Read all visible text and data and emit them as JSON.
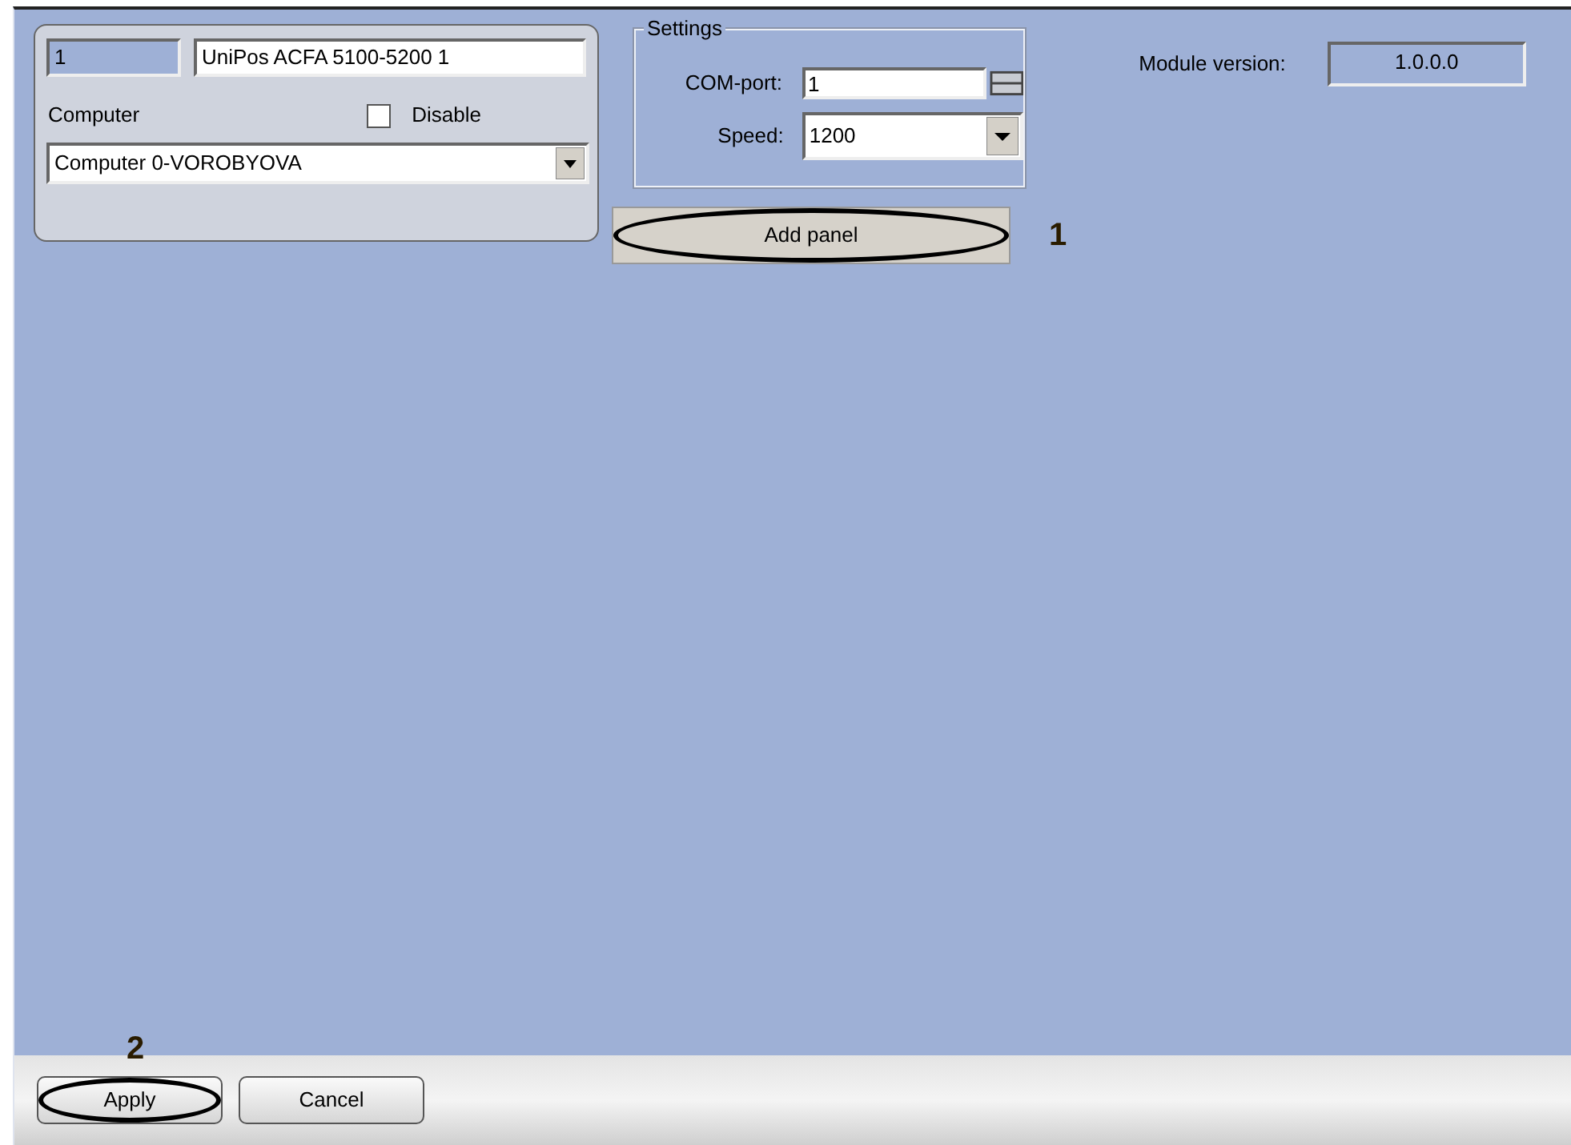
{
  "identity": {
    "number": "1",
    "name": "UniPos ACFA 5100-5200 1"
  },
  "computer": {
    "label": "Computer",
    "value": "Computer 0-VOROBYOVA"
  },
  "disable": {
    "label": "Disable",
    "checked": false
  },
  "settings": {
    "title": "Settings",
    "com_port": {
      "label": "COM-port:",
      "value": "1"
    },
    "speed": {
      "label": "Speed:",
      "value": "1200"
    }
  },
  "add_panel": {
    "label": "Add panel"
  },
  "module_version": {
    "label": "Module version:",
    "value": "1.0.0.0"
  },
  "buttons": [
    {
      "label": "Apply"
    },
    {
      "label": "Cancel"
    }
  ],
  "callouts": [
    {
      "label": "1"
    },
    {
      "label": "2"
    }
  ]
}
